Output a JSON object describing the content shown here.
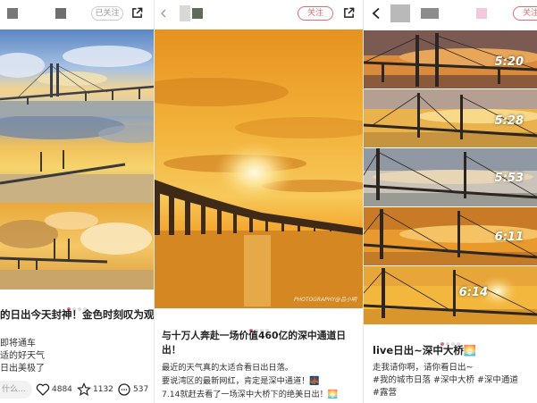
{
  "panel1": {
    "followed_label": "已关注",
    "title": "的日出今天封神！金色时刻叹为观",
    "body_lines": [
      "即将通车",
      "适的好天气",
      "日出美极了"
    ],
    "comment_placeholder": "什么...",
    "stats": {
      "likes": "4884",
      "favorites": "1132",
      "comments": "537"
    }
  },
  "panel2": {
    "follow_label": "关注",
    "watermark": "PHOTOGRAPHY@吕小明",
    "title_lines": [
      "与十万人奔赴一场价值460亿的深中通道日",
      "出！"
    ],
    "body_lines": [
      "最近的天气真的太适合看日出日落。",
      "要说湾区的最新网红，肯定是深中通道！🌉",
      "7.14就赶去看了一场深中大桥下的绝美日出！🌅"
    ]
  },
  "panel3": {
    "follow_label": "关注",
    "times": [
      "5:20",
      "5:28",
      "5:53",
      "6:11",
      "6:14"
    ],
    "title": "live日出~深中大桥🌅",
    "body_lines": [
      "走我请你啊，请你看日出~",
      "#我的城市日落 #深中大桥 #深中通道",
      "#露营"
    ]
  },
  "colors": {
    "accent": "#e36a72"
  }
}
